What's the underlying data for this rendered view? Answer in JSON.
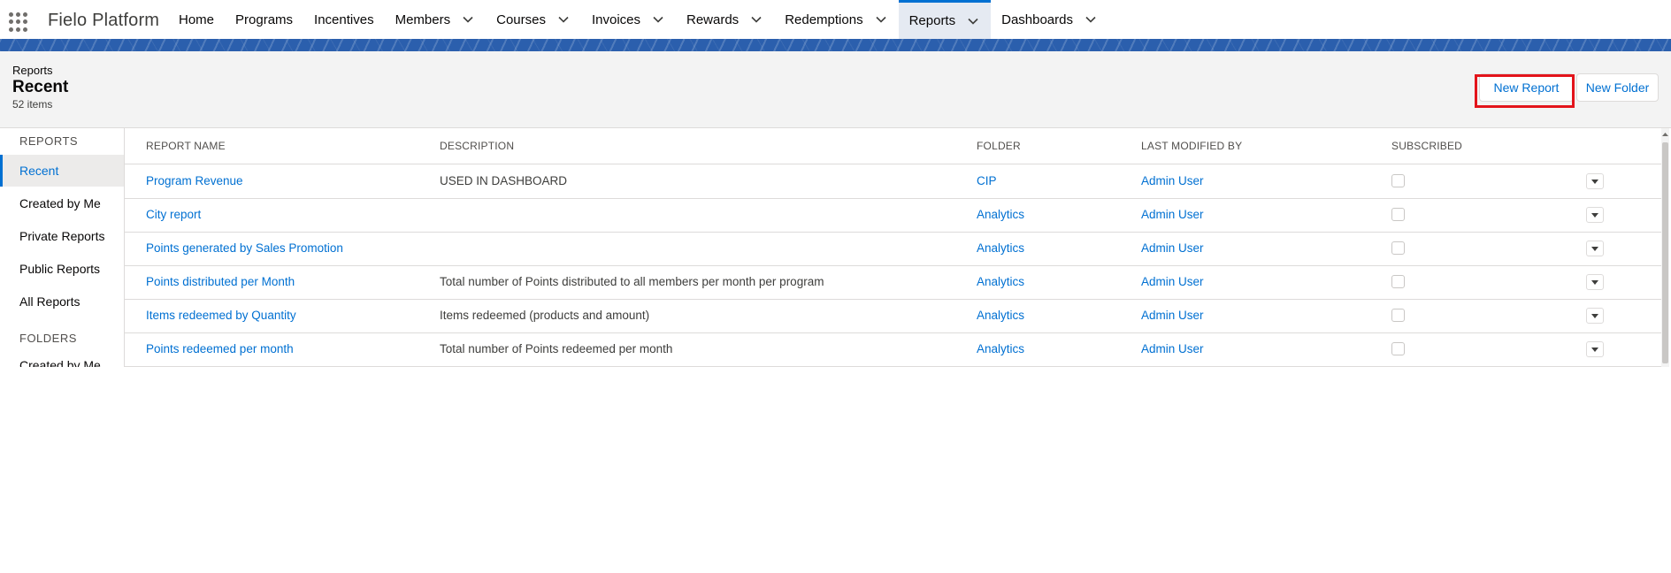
{
  "app": {
    "name": "Fielo Platform"
  },
  "nav": {
    "items": [
      {
        "label": "Home",
        "has_menu": false,
        "active": false
      },
      {
        "label": "Programs",
        "has_menu": false,
        "active": false
      },
      {
        "label": "Incentives",
        "has_menu": false,
        "active": false
      },
      {
        "label": "Members",
        "has_menu": true,
        "active": false
      },
      {
        "label": "Courses",
        "has_menu": true,
        "active": false
      },
      {
        "label": "Invoices",
        "has_menu": true,
        "active": false
      },
      {
        "label": "Rewards",
        "has_menu": true,
        "active": false
      },
      {
        "label": "Redemptions",
        "has_menu": true,
        "active": false
      },
      {
        "label": "Reports",
        "has_menu": true,
        "active": true
      },
      {
        "label": "Dashboards",
        "has_menu": true,
        "active": false
      }
    ]
  },
  "header": {
    "object": "Reports",
    "title": "Recent",
    "count": "52 items",
    "new_report_label": "New Report",
    "new_folder_label": "New Folder"
  },
  "sidebar": {
    "reports_heading": "REPORTS",
    "items": [
      "Recent",
      "Created by Me",
      "Private Reports",
      "Public Reports",
      "All Reports"
    ],
    "folders_heading": "FOLDERS",
    "folder_items": [
      "Created by Me"
    ]
  },
  "table": {
    "columns": [
      "REPORT NAME",
      "DESCRIPTION",
      "FOLDER",
      "LAST MODIFIED BY",
      "SUBSCRIBED"
    ],
    "rows": [
      {
        "name": "Program Revenue",
        "description": "USED IN DASHBOARD",
        "folder": "CIP",
        "modified_by": "Admin User",
        "subscribed": false
      },
      {
        "name": "City report",
        "description": "",
        "folder": "Analytics",
        "modified_by": "Admin User",
        "subscribed": false
      },
      {
        "name": "Points generated by Sales Promotion",
        "description": "",
        "folder": "Analytics",
        "modified_by": "Admin User",
        "subscribed": false
      },
      {
        "name": "Points distributed per Month",
        "description": "Total number of Points distributed to all members per month per program",
        "folder": "Analytics",
        "modified_by": "Admin User",
        "subscribed": false
      },
      {
        "name": "Items redeemed by Quantity",
        "description": "Items redeemed (products and amount)",
        "folder": "Analytics",
        "modified_by": "Admin User",
        "subscribed": false
      },
      {
        "name": "Points redeemed per month",
        "description": "Total number of Points redeemed per month",
        "folder": "Analytics",
        "modified_by": "Admin User",
        "subscribed": false
      }
    ]
  },
  "colors": {
    "accent": "#0070d2",
    "banner": "#2b5fad",
    "highlight": "#e3141b"
  }
}
